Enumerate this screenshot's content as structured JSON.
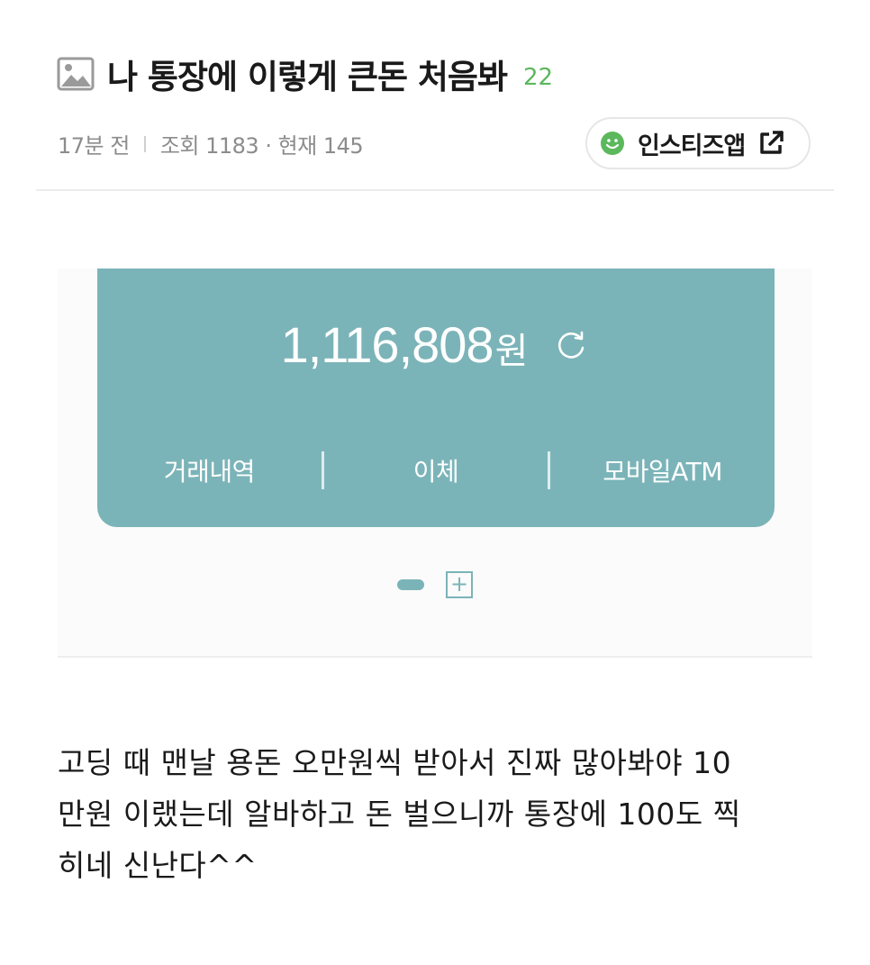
{
  "post": {
    "title": "나 통장에 이렇게 큰돈 처음봐",
    "comment_count": "22",
    "time_ago": "17분 전",
    "views": "조회 1183 · 현재 145",
    "app_button_label": "인스티즈앱"
  },
  "bank": {
    "balance_amount": "1,116,808",
    "balance_unit": "원",
    "actions": [
      "거래내역",
      "이체",
      "모바일ATM"
    ],
    "pager_add": "+"
  },
  "body": {
    "lines": [
      "고딩 때 맨날 용돈 오만원씩 받아서 진짜 많아봐야 10",
      "만원 이랬는데 알바하고 돈 벌으니까 통장에 100도 찍",
      "히네 신난다^^"
    ]
  },
  "colors": {
    "accent_green": "#5cb85c",
    "card_teal": "#7bb4b8"
  },
  "icons": {
    "title": "image-icon",
    "app": "smile-icon",
    "external": "external-link-icon",
    "refresh": "refresh-icon"
  }
}
